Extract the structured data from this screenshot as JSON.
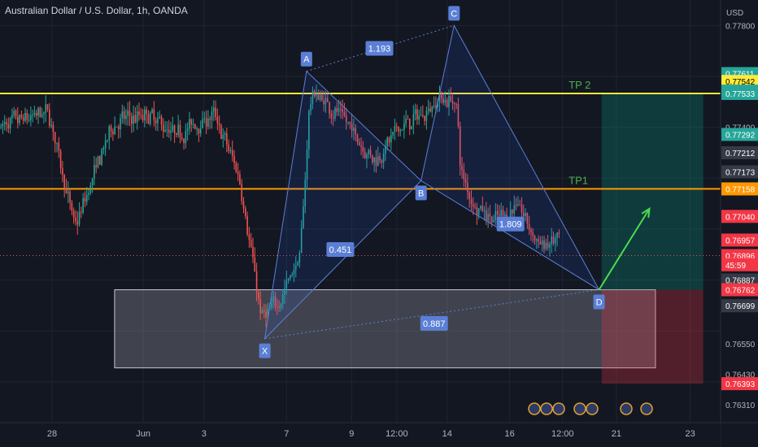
{
  "header": {
    "title": "Australian Dollar / U.S. Dollar, 1h, OANDA",
    "currency": "USD"
  },
  "chart_data": {
    "type": "candlestick",
    "symbol": "AUDUSD",
    "interval": "1h",
    "ylim": [
      0.7624,
      0.779
    ],
    "y_ticks": [
      "0.77800",
      "0.77400",
      "0.76550",
      "0.76430",
      "0.76310"
    ],
    "x_ticks": [
      {
        "label": "28",
        "t": 0.6
      },
      {
        "label": "Jun",
        "t": 1.65
      },
      {
        "label": "3",
        "t": 2.35
      },
      {
        "label": "7",
        "t": 3.3
      },
      {
        "label": "9",
        "t": 4.05
      },
      {
        "label": "12:00",
        "t": 4.57
      },
      {
        "label": "14",
        "t": 5.15
      },
      {
        "label": "16",
        "t": 5.87
      },
      {
        "label": "12:00",
        "t": 6.48
      },
      {
        "label": "21",
        "t": 7.1
      },
      {
        "label": "23",
        "t": 7.95
      }
    ],
    "price_labels": [
      {
        "value": "0.77611",
        "price": 0.77611,
        "color": "#26a69a"
      },
      {
        "value": "0.77542",
        "price": 0.7758,
        "color": "#ffeb3b"
      },
      {
        "value": "0.77542",
        "price": 0.77542,
        "color": "#26a69a"
      },
      {
        "value": "0.77533",
        "price": 0.77533,
        "color": "#26a69a"
      },
      {
        "value": "0.77292",
        "price": 0.77372,
        "color": "#26a69a"
      },
      {
        "value": "0.77212",
        "price": 0.773,
        "color": "#363a45"
      },
      {
        "value": "0.77173",
        "price": 0.77225,
        "color": "#363a45"
      },
      {
        "value": "0.77158",
        "price": 0.77158,
        "color": "#ff9800"
      },
      {
        "value": "0.77040",
        "price": 0.7705,
        "color": "#f23645"
      },
      {
        "value": "0.76957",
        "price": 0.76957,
        "color": "#f23645"
      },
      {
        "value": "0.76896",
        "price": 0.76896,
        "color": "#f23645"
      },
      {
        "value": "45:59",
        "price": 0.7686,
        "color": "#f23645"
      },
      {
        "value": "0.76887",
        "price": 0.768,
        "color": "#363a45"
      },
      {
        "value": "0.76762",
        "price": 0.76762,
        "color": "#f23645"
      },
      {
        "value": "0.76699",
        "price": 0.76699,
        "color": "#363a45"
      },
      {
        "value": "0.76393",
        "price": 0.76393,
        "color": "#f23645"
      }
    ],
    "levels": [
      {
        "name": "TP 2",
        "price": 0.77533,
        "color": "#ffeb3b",
        "label_t": 6.55
      },
      {
        "name": "TP1",
        "price": 0.77158,
        "color": "#ff9800",
        "label_t": 6.55
      }
    ],
    "pattern": {
      "points": [
        {
          "name": "X",
          "t": 3.05,
          "price": 0.7657
        },
        {
          "name": "A",
          "t": 3.53,
          "price": 0.7762
        },
        {
          "name": "B",
          "t": 4.85,
          "price": 0.7719
        },
        {
          "name": "C",
          "t": 5.23,
          "price": 0.778
        },
        {
          "name": "D",
          "t": 6.9,
          "price": 0.76762
        }
      ],
      "ratios": [
        {
          "value": "1.193",
          "t": 4.37,
          "price": 0.7771
        },
        {
          "value": "0.451",
          "t": 3.92,
          "price": 0.7692
        },
        {
          "value": "1.809",
          "t": 5.88,
          "price": 0.7702
        },
        {
          "value": "0.887",
          "t": 5.0,
          "price": 0.7663
        }
      ]
    },
    "demand_zone": {
      "t_start": 1.32,
      "t_end": 7.55,
      "price_top": 0.76762,
      "price_bottom": 0.76455
    },
    "position": {
      "t_start": 6.93,
      "t_end": 8.1,
      "entry": 0.76762,
      "target": 0.77533,
      "stop": 0.76393
    },
    "projection": [
      {
        "t": 6.9,
        "price": 0.76762
      },
      {
        "t": 7.48,
        "price": 0.7708
      }
    ],
    "seeded_series": {
      "seed": 7,
      "t_start": 0.0,
      "t_end": 6.45,
      "bars": 300
    }
  }
}
